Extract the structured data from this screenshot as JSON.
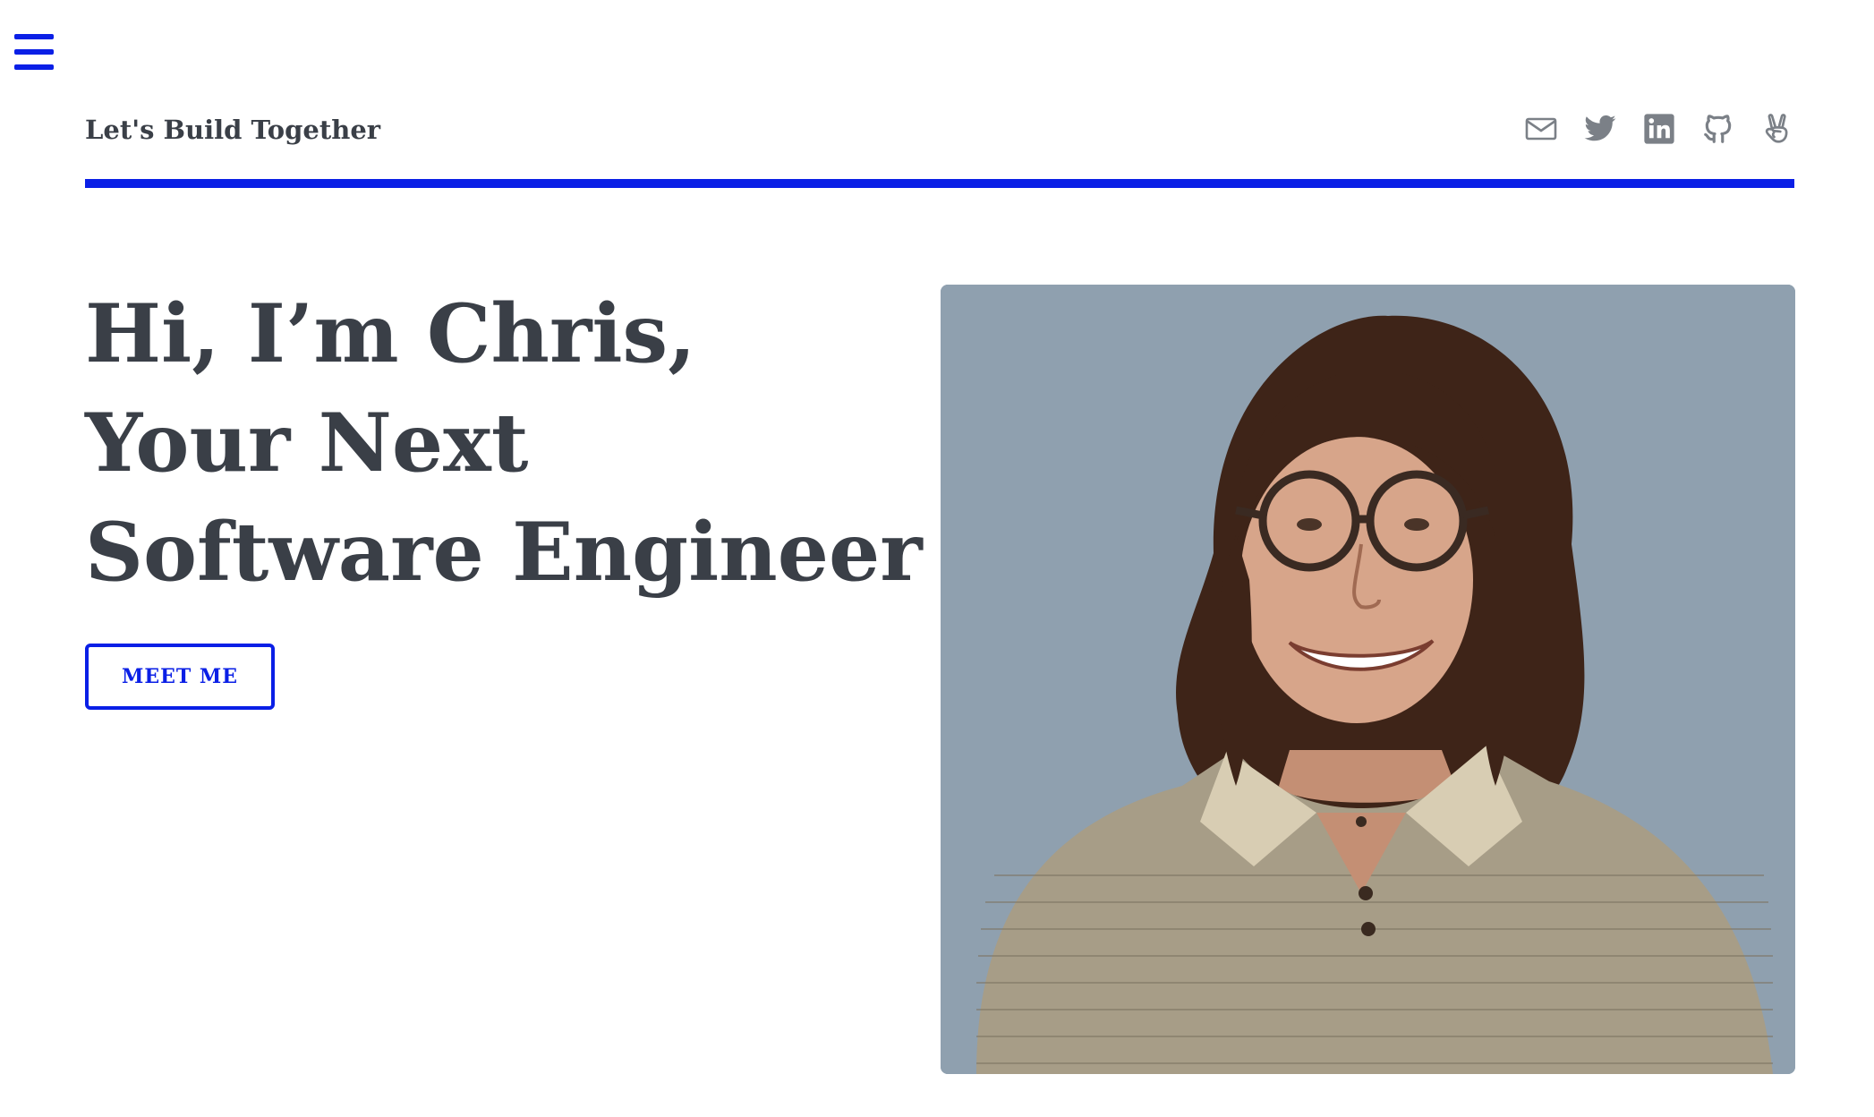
{
  "nav": {
    "menu_icon": "hamburger-menu-icon"
  },
  "header": {
    "brand": "Let's Build Together",
    "social": [
      {
        "icon": "envelope-icon",
        "name": "email"
      },
      {
        "icon": "twitter-icon",
        "name": "twitter"
      },
      {
        "icon": "linkedin-icon",
        "name": "linkedin"
      },
      {
        "icon": "github-icon",
        "name": "github"
      },
      {
        "icon": "angellist-icon",
        "name": "angellist"
      }
    ]
  },
  "hero": {
    "line1": "Hi, I’m Chris,",
    "line2": "Your Next",
    "line3": "Software Engineer",
    "cta_label": "MEET ME"
  },
  "colors": {
    "accent": "#0a1fe6",
    "text": "#3a3f47",
    "icon_gray": "#7b8087",
    "photo_bg": "#8fa0af"
  }
}
